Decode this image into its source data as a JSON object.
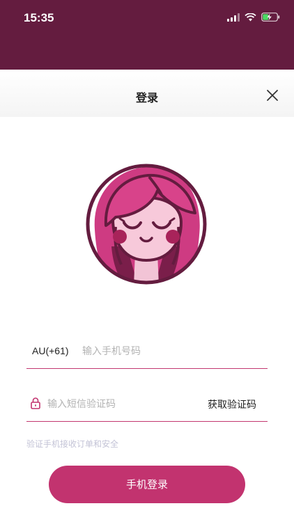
{
  "status_bar": {
    "time": "15:35",
    "icons": [
      "signal-icon",
      "wifi-icon",
      "battery-charging-icon"
    ]
  },
  "header": {
    "title": "登录",
    "close_icon": "close-icon"
  },
  "avatar": {
    "icon": "girl-avatar-illustration"
  },
  "form": {
    "country_code": "AU(+61)",
    "phone_placeholder": "输入手机号码",
    "code_placeholder": "输入短信验证码",
    "get_code_label": "获取验证码",
    "lock_icon": "lock-icon",
    "hint": "验证手机接收订单和安全",
    "login_label": "手机登录"
  },
  "colors": {
    "status_bar_bg": "#641c3f",
    "accent": "#c2336f",
    "hint_text": "#c3c3d6"
  }
}
